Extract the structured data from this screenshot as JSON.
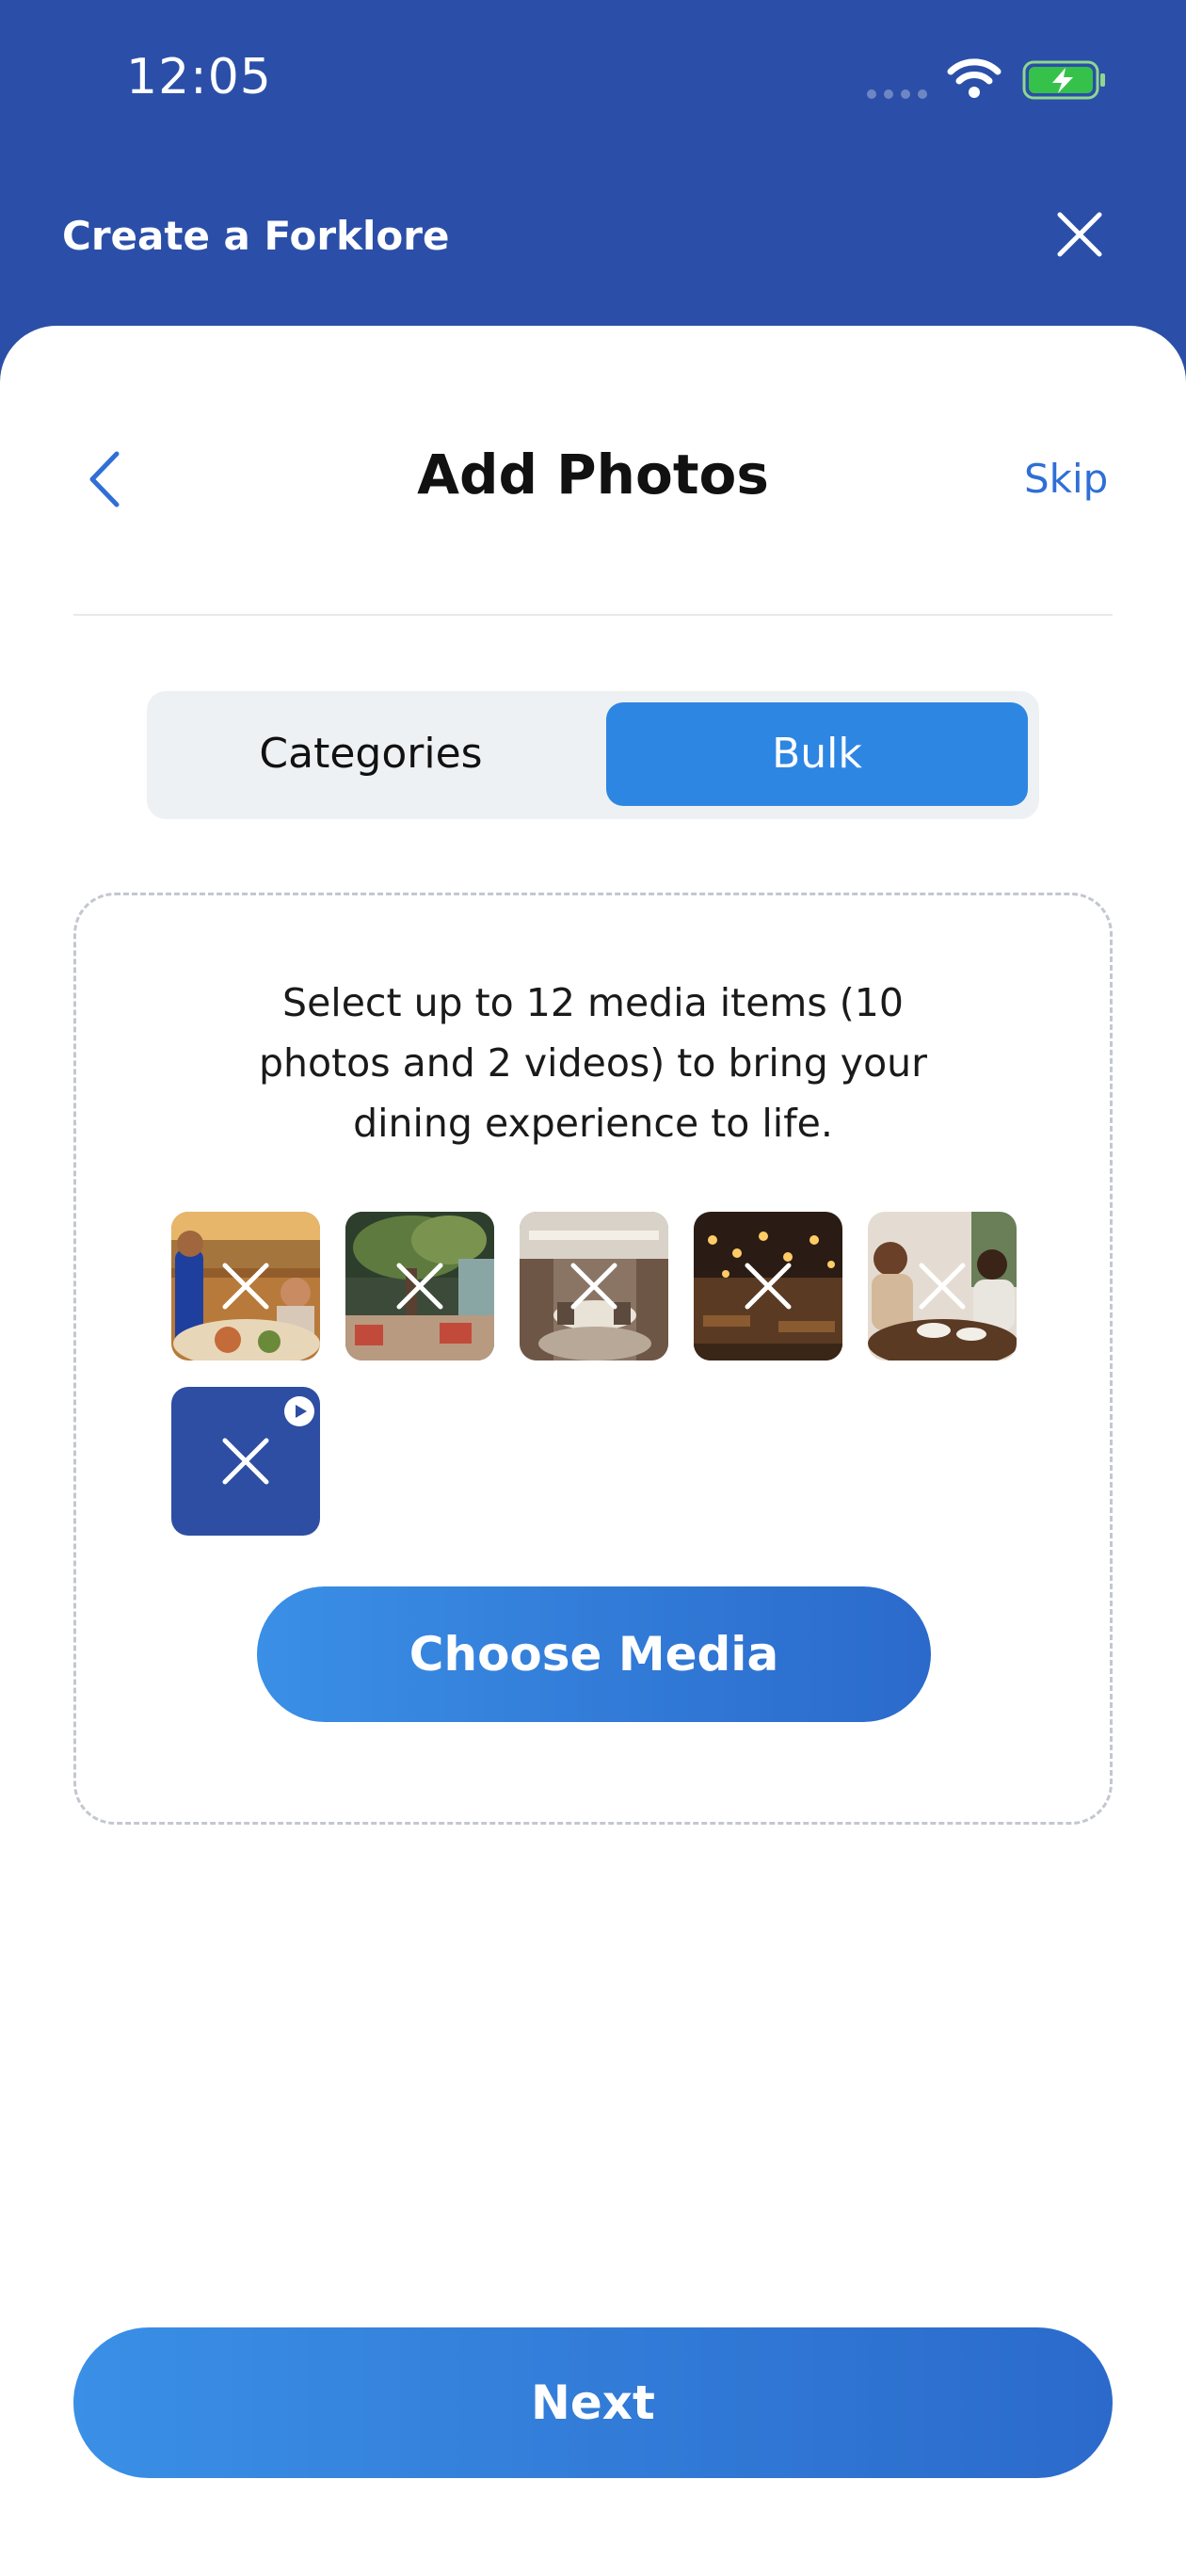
{
  "status_bar": {
    "time": "12:05",
    "icons": [
      "cellular-signal-icon",
      "wifi-icon",
      "battery-charging-icon"
    ]
  },
  "header": {
    "title": "Create a Forklore",
    "close_icon": "close-icon"
  },
  "page": {
    "title": "Add Photos",
    "back_icon": "chevron-left-icon",
    "skip_label": "Skip"
  },
  "tabs": [
    {
      "label": "Categories",
      "selected": false
    },
    {
      "label": "Bulk",
      "selected": true
    }
  ],
  "upload": {
    "instructions": "Select up to 12 media items (10 photos and 2 videos) to bring your dining experience to life.",
    "media": [
      {
        "type": "photo",
        "subject": "waiter-serving-diners",
        "remove_icon": "close-icon"
      },
      {
        "type": "photo",
        "subject": "patio-with-tree",
        "remove_icon": "close-icon"
      },
      {
        "type": "photo",
        "subject": "modern-dining-room",
        "remove_icon": "close-icon"
      },
      {
        "type": "photo",
        "subject": "dim-restaurant-with-lights",
        "remove_icon": "close-icon"
      },
      {
        "type": "photo",
        "subject": "diners-at-table",
        "remove_icon": "close-icon"
      },
      {
        "type": "video",
        "subject": "video-placeholder",
        "remove_icon": "close-icon",
        "badge_icon": "play-icon"
      }
    ],
    "choose_label": "Choose Media"
  },
  "footer": {
    "next_label": "Next"
  },
  "colors": {
    "header_bg": "#2b4fa8",
    "accent": "#2e86e3",
    "video_tile": "#2d4ea3"
  }
}
